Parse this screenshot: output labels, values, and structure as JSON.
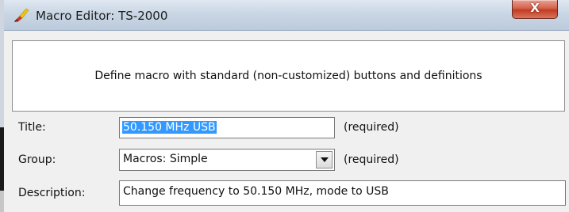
{
  "window": {
    "title": "Macro Editor: TS-2000",
    "close_glyph": "X",
    "icon": "brush-app-icon"
  },
  "banner": {
    "text": "Define macro with standard (non-customized) buttons and definitions"
  },
  "form": {
    "title": {
      "label": "Title:",
      "value": "50.150 MHz USB",
      "note": "(required)"
    },
    "group": {
      "label": "Group:",
      "value": "Macros: Simple",
      "note": "(required)"
    },
    "description": {
      "label": "Description:",
      "value": "Change frequency to 50.150 MHz, mode to USB"
    }
  },
  "colors": {
    "selection": "#3399ff",
    "close_button": "#c13c24",
    "titlebar": "#c9d6e4"
  }
}
